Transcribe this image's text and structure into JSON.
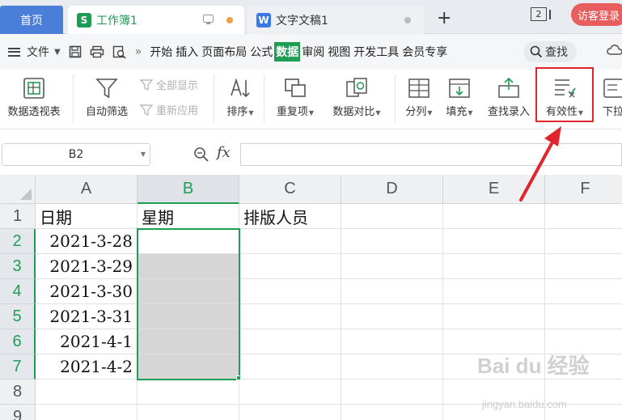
{
  "tabs": {
    "home": "首页",
    "active": {
      "badge": "S",
      "label": "工作簿1"
    },
    "doc": {
      "badge": "W",
      "label": "文字文稿1"
    },
    "new_tab": "+",
    "window_count": "2",
    "visitor_login": "访客登录"
  },
  "menu": {
    "file": "文件",
    "items": [
      "开始",
      "插入",
      "页面布局",
      "公式",
      "数据",
      "审阅",
      "视图",
      "开发工具",
      "会员专享"
    ],
    "selected": "数据",
    "search": "查找"
  },
  "ribbon": {
    "pivot": "数据透视表",
    "autofilter": "自动筛选",
    "show_all": "全部显示",
    "reapply": "重新应用",
    "sort": "排序",
    "duplicates": "重复项",
    "compare": "数据对比",
    "split": "分列",
    "fill": "填充",
    "lookup": "查找录入",
    "validity": "有效性",
    "dropdown": "下拉"
  },
  "formula": {
    "name_box": "B2",
    "fx": "fx",
    "value": ""
  },
  "sheet": {
    "columns": [
      "A",
      "B",
      "C",
      "D",
      "E",
      "F"
    ],
    "rows": [
      "1",
      "2",
      "3",
      "4",
      "5",
      "6",
      "7",
      "8",
      "9"
    ],
    "header_row": [
      "日期",
      "星期",
      "排版人员"
    ],
    "dates": [
      "2021-3-28",
      "2021-3-29",
      "2021-3-30",
      "2021-3-31",
      "2021-4-1",
      "2021-4-2"
    ],
    "selected_cell": "B2"
  },
  "watermark": {
    "main": "Bai du 经验",
    "sub": "jingyan.baidu.com"
  },
  "colors": {
    "accent": "#1f9d55",
    "highlight": "#e0262c",
    "home_tab": "#4a7ed8"
  }
}
